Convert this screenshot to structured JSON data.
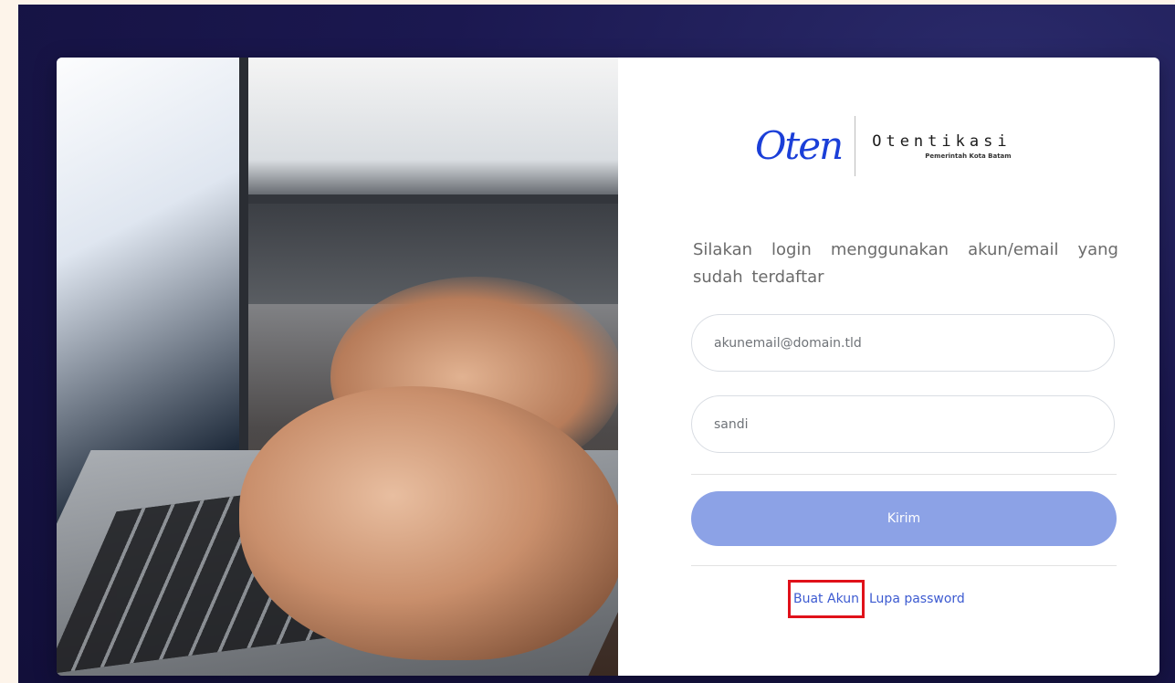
{
  "logo": {
    "script_text": "Oten",
    "title": "Otentikasi",
    "subtitle": "Pemerintah Kota Batam"
  },
  "login": {
    "instructions": "Silakan login menggunakan akun/email yang sudah terdaftar",
    "email_placeholder": "akunemail@domain.tld",
    "password_placeholder": "sandi",
    "submit_label": "Kirim"
  },
  "links": {
    "create_account": "Buat Akun",
    "forgot_password": "Lupa password"
  },
  "colors": {
    "accent": "#8ca2e6",
    "link": "#3d5bd1",
    "highlight": "#e0111a",
    "logo": "#1b3fd8"
  }
}
